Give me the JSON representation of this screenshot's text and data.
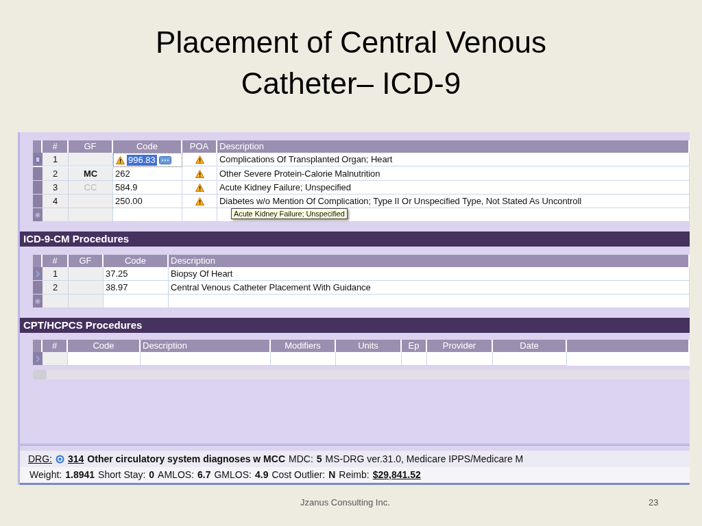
{
  "slide": {
    "title_lines": [
      "Placement of Central Venous",
      "Catheter– ICD-9"
    ],
    "footer": "Jzanus Consulting Inc.",
    "page": "23"
  },
  "diagnoses": {
    "columns": [
      "#",
      "GF",
      "Code",
      "POA",
      "Description"
    ],
    "rows": [
      {
        "num": "1",
        "gf": "",
        "code": "996.83",
        "editing": true,
        "code_warning": true,
        "poa_warning": true,
        "description": "Complications Of Transplanted Organ; Heart",
        "selected": true
      },
      {
        "num": "2",
        "gf": "MC",
        "gf_greyed": false,
        "code": "262",
        "editing": false,
        "code_warning": false,
        "poa_warning": true,
        "description": "Other Severe Protein-Calorie Malnutrition",
        "selected": false
      },
      {
        "num": "3",
        "gf": "CC",
        "gf_greyed": true,
        "code": "584.9",
        "editing": false,
        "code_warning": false,
        "poa_warning": true,
        "description": "Acute Kidney Failure; Unspecified",
        "selected": false
      },
      {
        "num": "4",
        "gf": "",
        "code": "250.00",
        "editing": false,
        "code_warning": false,
        "poa_warning": true,
        "description": "Diabetes w/o Mention Of Complication; Type II Or Unspecified Type, Not Stated As Uncontroll",
        "selected": false
      }
    ],
    "tooltip": "Acute Kidney Failure; Unspecified"
  },
  "procedures": {
    "title": "ICD-9-CM Procedures",
    "columns": [
      "#",
      "GF",
      "Code",
      "Description"
    ],
    "rows": [
      {
        "num": "1",
        "gf": "",
        "code": "37.25",
        "description": "Biopsy Of Heart",
        "selected": true
      },
      {
        "num": "2",
        "gf": "",
        "code": "38.97",
        "description": "Central Venous Catheter Placement With Guidance",
        "selected": false
      }
    ]
  },
  "cpt": {
    "title": "CPT/HCPCS Procedures",
    "columns": [
      "#",
      "Code",
      "Description",
      "Modifiers",
      "Units",
      "Ep",
      "Provider",
      "Date"
    ]
  },
  "drg": {
    "label": "DRG:",
    "code": "314",
    "title": "Other circulatory system diagnoses w MCC",
    "mdc_label": "MDC:",
    "mdc": "5",
    "version": "MS-DRG ver.31.0, Medicare IPPS/Medicare M"
  },
  "stats": [
    {
      "label": "Weight:",
      "value": "1.8941",
      "kind": "plain"
    },
    {
      "label": "Short Stay:",
      "value": "0",
      "kind": "plain"
    },
    {
      "label": "AMLOS:",
      "value": "6.7",
      "kind": "plain"
    },
    {
      "label": "GMLOS:",
      "value": "4.9",
      "kind": "plain"
    },
    {
      "label": "Cost Outlier:",
      "value": "N",
      "kind": "plain"
    },
    {
      "label": "Reimb:",
      "value": "$29,841.52",
      "kind": "link"
    }
  ]
}
